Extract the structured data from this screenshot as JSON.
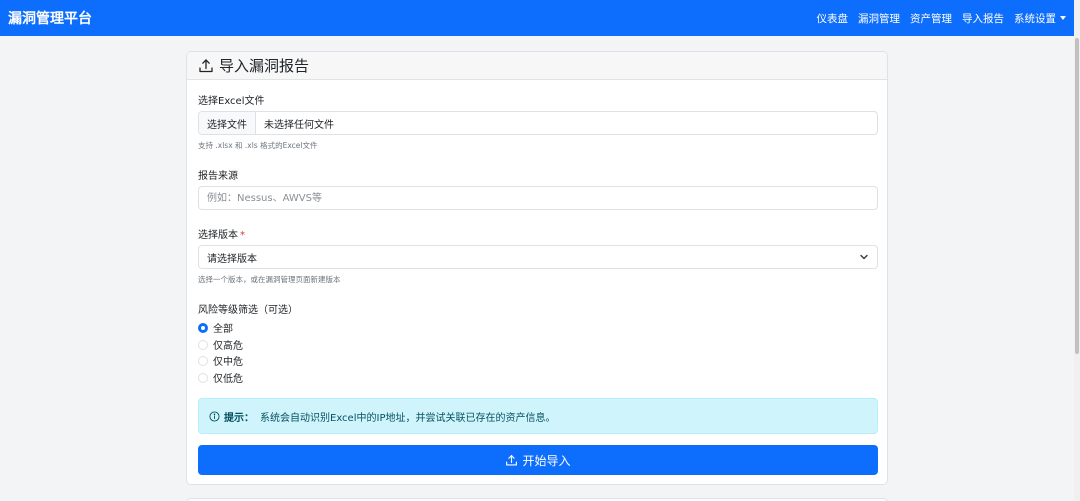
{
  "navbar": {
    "brand": "漏洞管理平台",
    "links": [
      "仪表盘",
      "漏洞管理",
      "资产管理",
      "导入报告",
      "系统设置"
    ]
  },
  "card": {
    "title": "导入漏洞报告",
    "file": {
      "label": "选择Excel文件",
      "button": "选择文件",
      "filename": "未选择任何文件",
      "help": "支持 .xlsx 和 .xls 格式的Excel文件"
    },
    "source": {
      "label": "报告来源",
      "placeholder": "例如：Nessus、AWVS等",
      "value": ""
    },
    "version": {
      "label": "选择版本",
      "required_mark": "*",
      "selected": "请选择版本",
      "help": "选择一个版本，或在漏洞管理页面新建版本"
    },
    "risk": {
      "label": "风险等级筛选（可选）",
      "options": [
        "全部",
        "仅高危",
        "仅中危",
        "仅低危"
      ],
      "selected_index": 0
    },
    "alert": {
      "title": "提示：",
      "text": "系统会自动识别Excel中的IP地址，并尝试关联已存在的资产信息。"
    },
    "submit_label": "开始导入"
  },
  "colors": {
    "primary": "#0d6efd",
    "alert_bg": "#cff4fc",
    "alert_text": "#055160",
    "required": "#dc3545"
  },
  "icons": {
    "header": "upload-icon",
    "alert": "info-circle-icon",
    "submit": "upload-icon",
    "select": "chevron-down-icon",
    "settings_menu": "caret-down-icon"
  }
}
